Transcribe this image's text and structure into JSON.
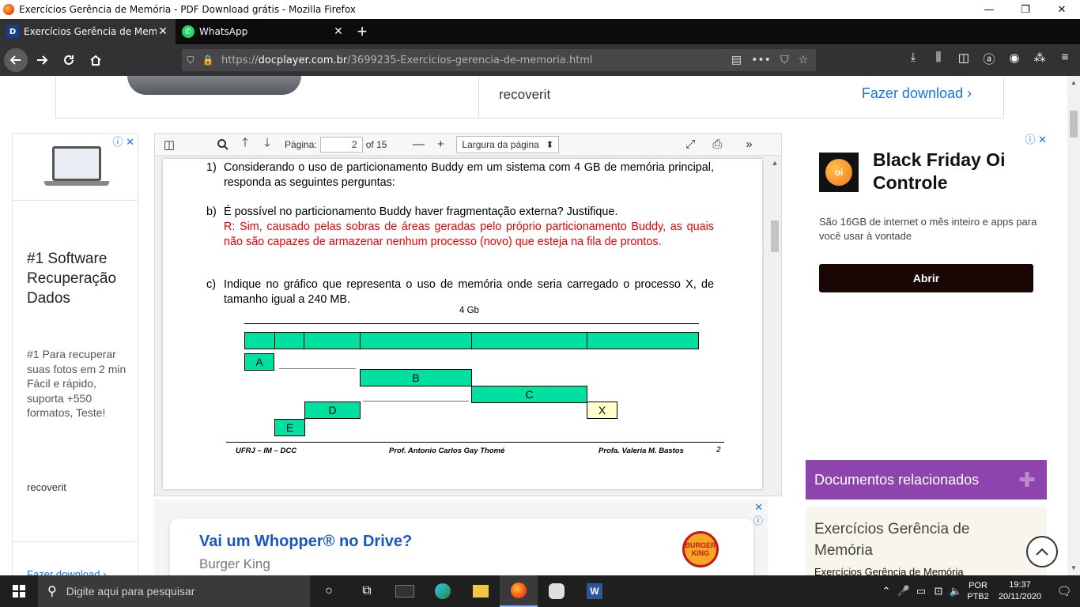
{
  "window": {
    "title": "Exercícios Gerência de Memória - PDF Download grátis - Mozilla Firefox",
    "controls": {
      "minimize": "—",
      "restore": "❐",
      "close": "✕"
    }
  },
  "tabs": [
    {
      "favicon": "D",
      "title": "Exercícios Gerência de Memória",
      "close": "✕"
    },
    {
      "favicon": "✆",
      "title": "WhatsApp",
      "close": "✕"
    }
  ],
  "new_tab": "+",
  "url": {
    "prefix": "https://",
    "domain": "docplayer.com.br",
    "path": "/3699235-Exercicios-gerencia-de-memoria.html"
  },
  "top_banner": {
    "brand": "recoverit",
    "download": "Fazer download ›"
  },
  "left_ad": {
    "headline": "#1 Software Recuperação Dados",
    "body": "#1 Para recuperar suas fotos em 2 min Fácil e rápido, suporta +550 formatos, Teste!",
    "brand": "recoverit",
    "download": "Fazer download ›",
    "adchoice": "ⓘ ✕"
  },
  "viewer": {
    "page_label": "Página:",
    "page_value": "2",
    "page_total": "of 15",
    "zoom": "Largura da página",
    "zoom_caret": "⬍"
  },
  "pdf": {
    "q1_num": "1)",
    "q1_text": "Considerando o uso de particionamento Buddy em um sistema com 4 GB de memória principal, responda as seguintes perguntas:",
    "qb_num": "b)",
    "qb_text": "É possível no particionamento Buddy haver fragmentação externa? Justifique.",
    "qb_answer": "R: Sim, causado pelas sobras de áreas geradas pelo próprio particionamento Buddy, as quais não são capazes de armazenar nenhum processo (novo) que esteja na fila de prontos.",
    "qc_num": "c)",
    "qc_text": "Indique no gráfico que representa o uso de memória onde seria carregado o processo X, de tamanho igual a 240 MB.",
    "diagram_title": "4 Gb",
    "blocks": {
      "a": "A",
      "b": "B",
      "c": "C",
      "d": "D",
      "e": "E",
      "x": "X"
    },
    "footer_left": "UFRJ – IM – DCC",
    "footer_center": "Prof. Antonio Carlos Gay Thomé",
    "footer_right": "Profa. Valeria M. Bastos",
    "page_number": "2"
  },
  "bottom_ad": {
    "headline": "Vai um Whopper® no Drive?",
    "brand": "Burger King",
    "logo": "BURGER KING"
  },
  "right_ad": {
    "logo": "oi",
    "headline": "Black Friday Oi Controle",
    "body": "São 16GB de internet o mês inteiro e apps para você usar à vontade",
    "cta": "Abrir",
    "adchoice": "ⓘ ✕"
  },
  "related": {
    "header": "Documentos relacionados",
    "card_title": "Exercícios Gerência de Memória",
    "card_snippet": "Exercícios Gerência de Memória"
  },
  "taskbar": {
    "search_placeholder": "Digite aqui para pesquisar",
    "lang_1": "POR",
    "lang_2": "PTB2",
    "time": "19:37",
    "date": "20/11/2020"
  }
}
